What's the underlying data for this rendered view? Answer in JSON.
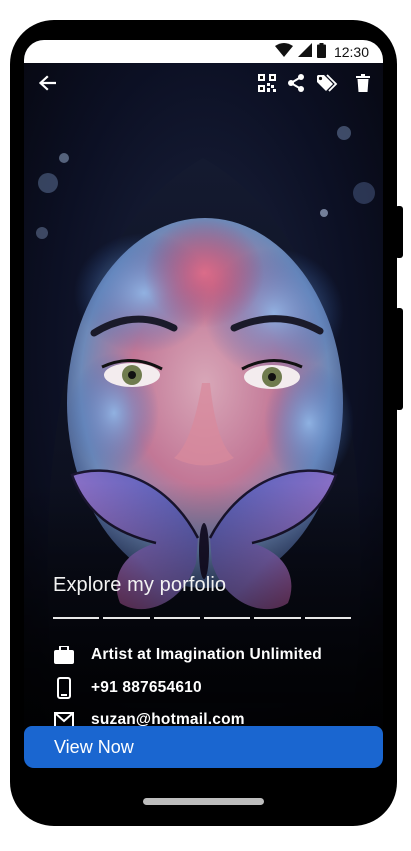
{
  "status_bar": {
    "time": "12:30"
  },
  "toolbar": {
    "back_icon": "arrow-left-icon",
    "qr_icon": "qr-code-icon",
    "share_icon": "share-icon",
    "tag_icon": "tags-icon",
    "delete_icon": "trash-icon"
  },
  "profile": {
    "headline": "Explore my porfolio",
    "story_segments": 6,
    "details": [
      {
        "icon": "briefcase-icon",
        "text": "Artist at Imagination Unlimited"
      },
      {
        "icon": "phone-icon",
        "text": "+91 887654610"
      },
      {
        "icon": "mail-icon",
        "text": "suzan@hotmail.com"
      }
    ]
  },
  "cta": {
    "label": "View Now"
  },
  "colors": {
    "accent": "#1a66d0",
    "phone_frame": "#000000",
    "text": "#ffffff"
  }
}
